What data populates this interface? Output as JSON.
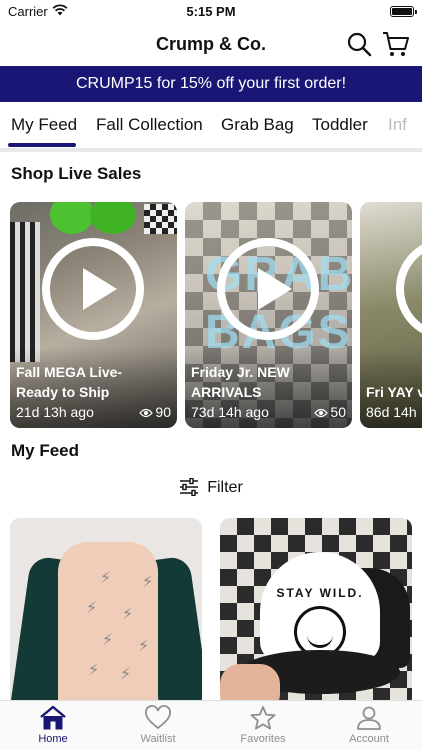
{
  "status_bar": {
    "carrier": "Carrier",
    "time": "5:15 PM"
  },
  "header": {
    "title": "Crump & Co."
  },
  "promo": {
    "text": "CRUMP15 for 15% off your first order!"
  },
  "tabs": [
    {
      "label": "My Feed",
      "active": true
    },
    {
      "label": "Fall Collection"
    },
    {
      "label": "Grab Bag"
    },
    {
      "label": "Toddler"
    },
    {
      "label": "Inf"
    }
  ],
  "live": {
    "title": "Shop Live Sales",
    "cards": [
      {
        "title": "Fall MEGA Live- Ready to Ship",
        "age": "21d 13h ago",
        "views": "90"
      },
      {
        "title": "Friday Jr. NEW ARRIVALS",
        "age": "73d 14h ago",
        "views": "50",
        "overlay": "GRAB BAGS"
      },
      {
        "title": "Fri YAY v",
        "age": "86d 14h",
        "views": ""
      }
    ]
  },
  "feed": {
    "title": "My Feed",
    "filter_label": "Filter",
    "hat_text": "STAY WILD."
  },
  "tabbar": [
    {
      "label": "Home",
      "icon": "home-icon",
      "active": true
    },
    {
      "label": "Waitlist",
      "icon": "heart-icon"
    },
    {
      "label": "Favorites",
      "icon": "star-icon"
    },
    {
      "label": "Account",
      "icon": "person-icon"
    }
  ],
  "colors": {
    "brand": "#1a1675",
    "inactive": "#8e8e93"
  }
}
